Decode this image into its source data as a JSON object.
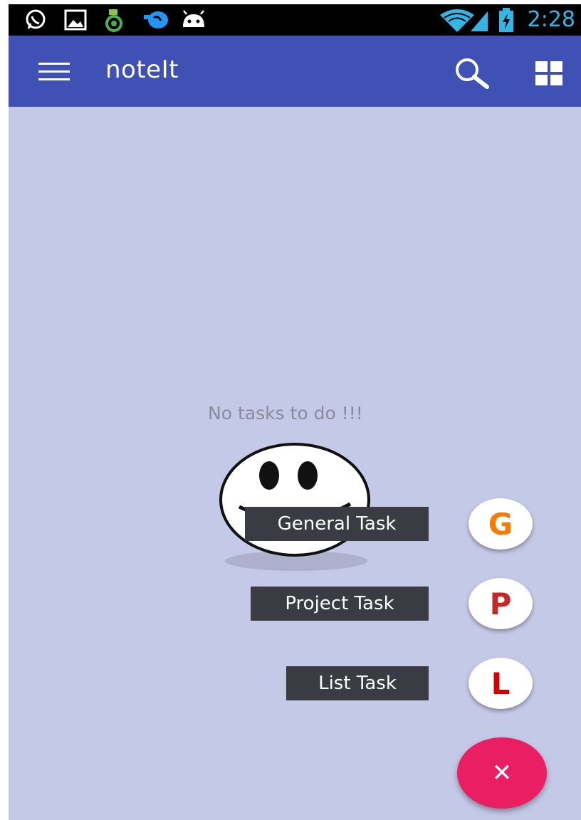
{
  "status_bar": {
    "time": "2:28",
    "icons": [
      "whatsapp-icon",
      "gallery-icon",
      "android-battery-app-icon",
      "app-notification-icon",
      "android-debug-icon",
      "wifi-icon",
      "signal-icon",
      "battery-charging-icon"
    ]
  },
  "app_bar": {
    "title": "noteIt",
    "menu_icon": "hamburger-menu-icon",
    "search_icon": "search-icon",
    "view_icon": "grid-view-icon",
    "color": "#3f51b5"
  },
  "main": {
    "background": "#c5c9e8",
    "empty_message": "No tasks to do !!!",
    "empty_image": "smiley-face"
  },
  "fab_menu": {
    "items": [
      {
        "label": "General Task",
        "letter": "G",
        "letter_color": "#f57c00"
      },
      {
        "label": "Project Task",
        "letter": "P",
        "letter_color": "#c62828"
      },
      {
        "label": "List Task",
        "letter": "L",
        "letter_color": "#d50000"
      }
    ],
    "close_icon": "close-icon",
    "close_glyph": "✕",
    "fab_color": "#e91e63"
  }
}
